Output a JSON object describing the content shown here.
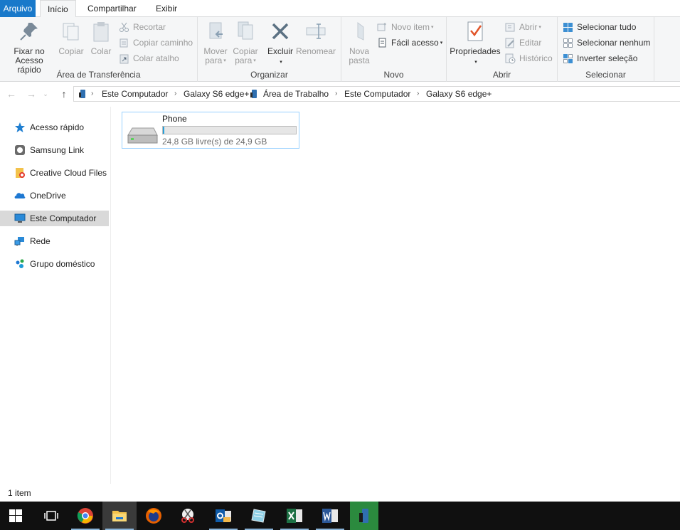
{
  "tabs": {
    "file": "Arquivo",
    "home": "Início",
    "share": "Compartilhar",
    "view": "Exibir"
  },
  "ribbon": {
    "clipboard": {
      "label": "Área de Transferência",
      "pin": "Fixar no\nAcesso rápido",
      "copy": "Copiar",
      "paste": "Colar",
      "cut": "Recortar",
      "copy_path": "Copiar caminho",
      "paste_shortcut": "Colar atalho"
    },
    "organize": {
      "label": "Organizar",
      "move_to": "Mover\npara",
      "copy_to": "Copiar\npara",
      "delete": "Excluir",
      "rename": "Renomear"
    },
    "new": {
      "label": "Novo",
      "new_folder": "Nova\npasta",
      "new_item": "Novo item",
      "easy_access": "Fácil acesso"
    },
    "open": {
      "label": "Abrir",
      "properties": "Propriedades",
      "open": "Abrir",
      "edit": "Editar",
      "history": "Histórico"
    },
    "select": {
      "label": "Selecionar",
      "select_all": "Selecionar tudo",
      "select_none": "Selecionar nenhum",
      "invert": "Inverter seleção"
    }
  },
  "breadcrumb": [
    "Este Computador",
    "Galaxy S6 edge+",
    "Área de Trabalho",
    "Este Computador",
    "Galaxy S6 edge+"
  ],
  "nav": [
    {
      "label": "Acesso rápido",
      "icon": "star-icon"
    },
    {
      "label": "Samsung Link",
      "icon": "samsung-link-icon"
    },
    {
      "label": "Creative Cloud Files",
      "icon": "creative-cloud-folder-icon"
    },
    {
      "label": "OneDrive",
      "icon": "onedrive-cloud-icon"
    },
    {
      "label": "Este Computador",
      "icon": "computer-icon"
    },
    {
      "label": "Rede",
      "icon": "network-icon"
    },
    {
      "label": "Grupo doméstico",
      "icon": "homegroup-icon"
    }
  ],
  "drive": {
    "name": "Phone",
    "space": "24,8 GB livre(s) de 24,9 GB",
    "used_fraction": 0.004
  },
  "status": {
    "count": "1 item"
  },
  "colors": {
    "accent": "#1979ca",
    "bar_fill": "#26a0da",
    "taskbar": "#101010"
  }
}
